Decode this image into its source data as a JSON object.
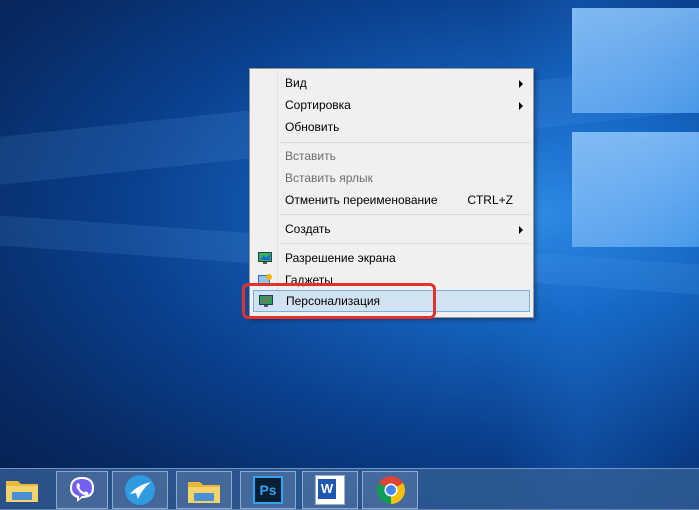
{
  "context_menu": {
    "items": [
      {
        "label": "Вид",
        "submenu": true
      },
      {
        "label": "Сортировка",
        "submenu": true
      },
      {
        "label": "Обновить"
      },
      {
        "label": "Вставить",
        "disabled": true
      },
      {
        "label": "Вставить ярлык",
        "disabled": true
      },
      {
        "label": "Отменить переименование",
        "shortcut": "CTRL+Z"
      },
      {
        "label": "Создать",
        "submenu": true
      },
      {
        "label": "Разрешение экрана",
        "icon": "display-icon"
      },
      {
        "label": "Гаджеты",
        "icon": "gadgets-icon"
      },
      {
        "label": "Персонализация",
        "icon": "personalize-icon",
        "highlighted": true
      }
    ]
  },
  "highlight_color": "#e4322b",
  "taskbar": {
    "apps": [
      {
        "name": "file-explorer-icon"
      },
      {
        "name": "viber-icon"
      },
      {
        "name": "messenger-icon"
      },
      {
        "name": "file-explorer-icon"
      },
      {
        "name": "photoshop-icon",
        "text": "Ps"
      },
      {
        "name": "word-icon",
        "text": "W"
      },
      {
        "name": "chrome-icon"
      }
    ]
  }
}
